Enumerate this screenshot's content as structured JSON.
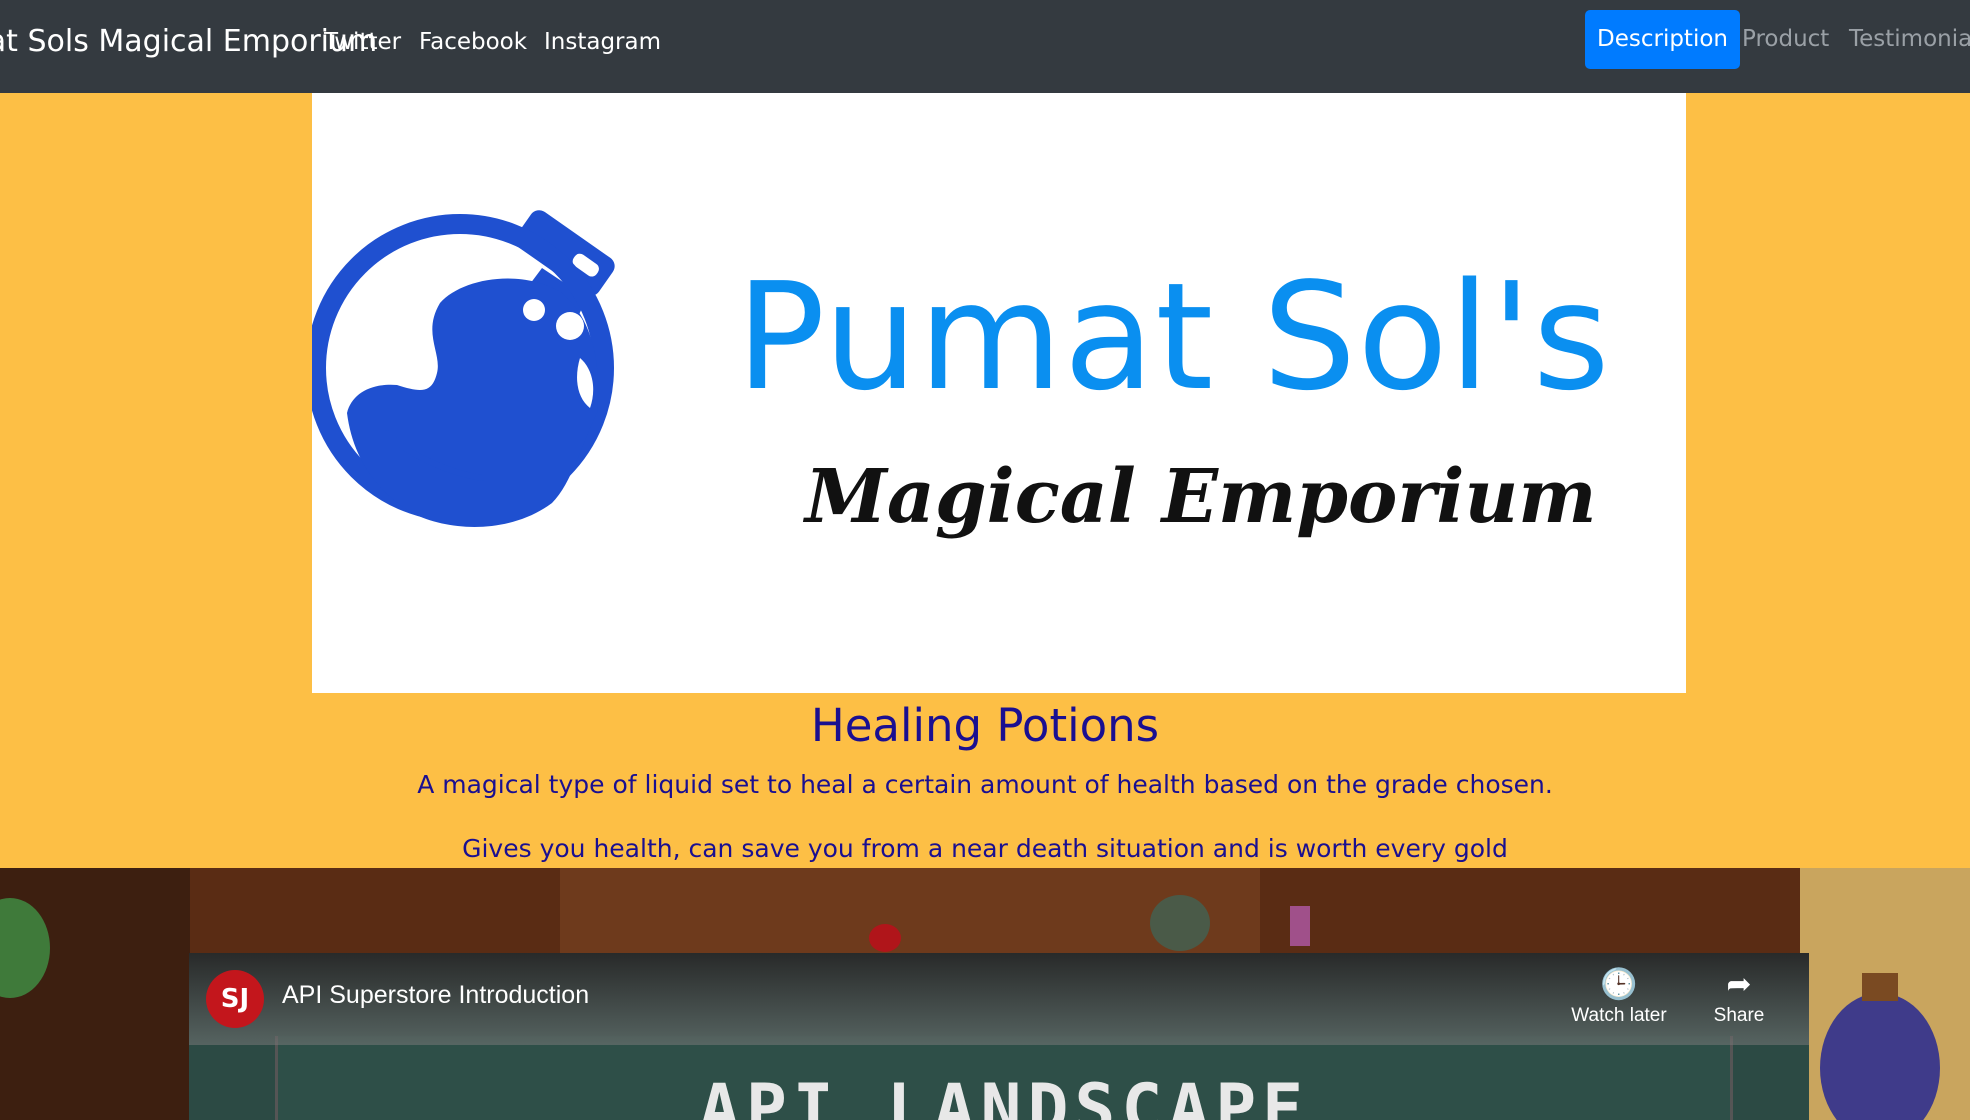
{
  "navbar": {
    "brand": "Pumat Sols Magical Emporium",
    "social": [
      "Twitter",
      "Facebook",
      "Instagram"
    ],
    "nav_items": [
      "Description",
      "Product",
      "Testimonial"
    ],
    "active_item": "Description",
    "background": "#343a40",
    "accent": "#007bff"
  },
  "hero": {
    "logo_title": "Pumat Sol's",
    "logo_subtitle": "Magical Emporium",
    "logo_icon": "potion-bottle-icon",
    "logo_color": "#1f50d0"
  },
  "content": {
    "heading": "Healing Potions",
    "paragraph_1": "A magical type of liquid set to heal a certain amount of health based on the grade chosen.",
    "paragraph_2": "Gives you health, can save you from a near death situation and is worth every gold",
    "text_color": "#1a0f91",
    "background": "#fdbf45"
  },
  "video": {
    "channel_icon": "channel-logo-icon",
    "channel_initials": "SJ",
    "title": "API Superstore Introduction",
    "watch_later_label": "Watch later",
    "share_label": "Share",
    "slide_text": "API LANDSCAPE"
  }
}
